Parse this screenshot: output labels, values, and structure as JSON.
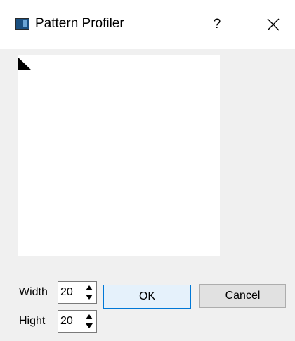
{
  "window": {
    "title": "Pattern Profiler",
    "help_label": "?",
    "icons": {
      "app": "app-icon",
      "close": "close-icon"
    }
  },
  "canvas": {
    "marker_icon": "corner-triangle-icon"
  },
  "form": {
    "width_label": "Width",
    "width_value": "20",
    "hight_label": "Hight",
    "hight_value": "20"
  },
  "buttons": {
    "ok_label": "OK",
    "cancel_label": "Cancel"
  },
  "colors": {
    "accent": "#0078d7",
    "ok_bg": "#e5f1fb",
    "dialog_bg": "#f0f0f0"
  }
}
